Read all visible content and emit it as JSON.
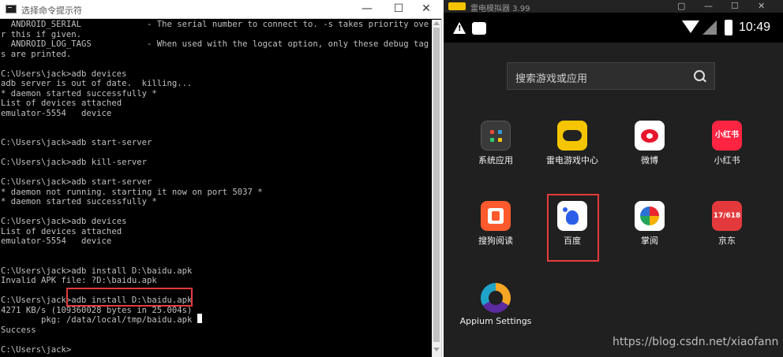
{
  "cmd": {
    "title": "选择命令提示符",
    "window_buttons": {
      "minimize": "—",
      "maximize": "☐",
      "close": "✕"
    },
    "lines": [
      "  ANDROID_SERIAL             - The serial number to connect to. -s takes priority ove",
      "r this if given.",
      "  ANDROID_LOG_TAGS           - When used with the logcat option, only these debug tag",
      "s are printed.",
      "",
      "C:\\Users\\jack>adb devices",
      "adb server is out of date.  killing...",
      "* daemon started successfully *",
      "List of devices attached",
      "emulator-5554   device",
      "",
      "",
      "C:\\Users\\jack>adb start-server",
      "",
      "C:\\Users\\jack>adb kill-server",
      "",
      "C:\\Users\\jack>adb start-server",
      "* daemon not running. starting it now on port 5037 *",
      "* daemon started successfully *",
      "",
      "C:\\Users\\jack>adb devices",
      "List of devices attached",
      "emulator-5554   device",
      "",
      "",
      "C:\\Users\\jack>adb install D:\\baidu.apk",
      "Invalid APK file: ?D:\\baidu.apk",
      "",
      "C:\\Users\\jack>adb install D:\\baidu.apk",
      "4271 KB/s (109360028 bytes in 25.004s)",
      "        pkg: /data/local/tmp/baidu.apk",
      "Success",
      "",
      "C:\\Users\\jack>"
    ]
  },
  "emulator": {
    "title": "雷电模拟器 3.99",
    "controls": [
      "▢",
      "—",
      "☐",
      "✕"
    ],
    "status": {
      "time": "10:49",
      "warning_mark": "!"
    },
    "search_placeholder": "搜索游戏或应用",
    "apps": [
      {
        "label": "系统应用",
        "icon": "system-apps-icon"
      },
      {
        "label": "雷电游戏中心",
        "icon": "game-center-icon"
      },
      {
        "label": "微博",
        "icon": "weibo-icon"
      },
      {
        "label": "小红书",
        "icon": "xiaohongshu-icon",
        "icon_text": "小红书"
      },
      {
        "label": "搜狗阅读",
        "icon": "sogou-reader-icon"
      },
      {
        "label": "百度",
        "icon": "baidu-icon"
      },
      {
        "label": "掌阅",
        "icon": "zhangyue-icon"
      },
      {
        "label": "京东",
        "icon": "jd-icon",
        "icon_text": "17/618"
      },
      {
        "label": "Appium Settings",
        "icon": "appium-settings-icon"
      }
    ],
    "watermark": "https://blog.csdn.net/xiaofann"
  },
  "colors": {
    "highlight": "#e53b3b",
    "console_text": "#c0c0c0",
    "console_bg": "#000000"
  }
}
